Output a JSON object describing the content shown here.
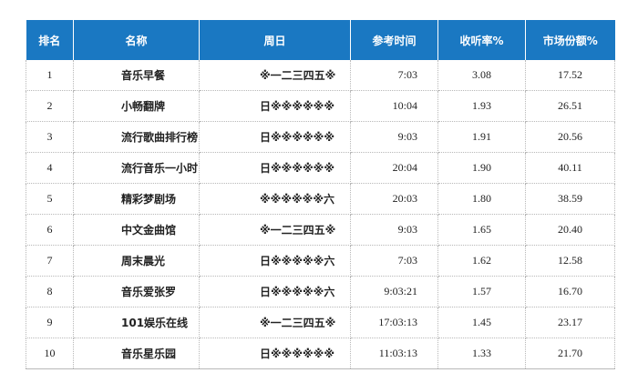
{
  "headers": [
    "排名",
    "名称",
    "周日",
    "参考时间",
    "收听率%",
    "市场份额%"
  ],
  "rows": [
    {
      "rank": "1",
      "name": "音乐早餐",
      "week": "※一二三四五※",
      "time": "7:03",
      "rating": "3.08",
      "share": "17.52"
    },
    {
      "rank": "2",
      "name": "小畅翻牌",
      "week": "日※※※※※※",
      "time": "10:04",
      "rating": "1.93",
      "share": "26.51"
    },
    {
      "rank": "3",
      "name": "流行歌曲排行榜",
      "week": "日※※※※※※",
      "time": "9:03",
      "rating": "1.91",
      "share": "20.56"
    },
    {
      "rank": "4",
      "name": "流行音乐一小时",
      "week": "日※※※※※※",
      "time": "20:04",
      "rating": "1.90",
      "share": "40.11"
    },
    {
      "rank": "5",
      "name": "精彩梦剧场",
      "week": "※※※※※※六",
      "time": "20:03",
      "rating": "1.80",
      "share": "38.59"
    },
    {
      "rank": "6",
      "name": "中文金曲馆",
      "week": "※一二三四五※",
      "time": "9:03",
      "rating": "1.65",
      "share": "20.40"
    },
    {
      "rank": "7",
      "name": "周末晨光",
      "week": "日※※※※※六",
      "time": "7:03",
      "rating": "1.62",
      "share": "12.58"
    },
    {
      "rank": "8",
      "name": "音乐爱张罗",
      "week": "日※※※※※六",
      "time": "9:03:21",
      "rating": "1.57",
      "share": "16.70"
    },
    {
      "rank": "9",
      "name": "101娱乐在线",
      "week": "※一二三四五※",
      "time": "17:03:13",
      "rating": "1.45",
      "share": "23.17"
    },
    {
      "rank": "10",
      "name": "音乐星乐园",
      "week": "日※※※※※※",
      "time": "11:03:13",
      "rating": "1.33",
      "share": "21.70"
    }
  ],
  "colors": {
    "header_bg": "#1a78c2",
    "header_text": "#ffffff"
  }
}
